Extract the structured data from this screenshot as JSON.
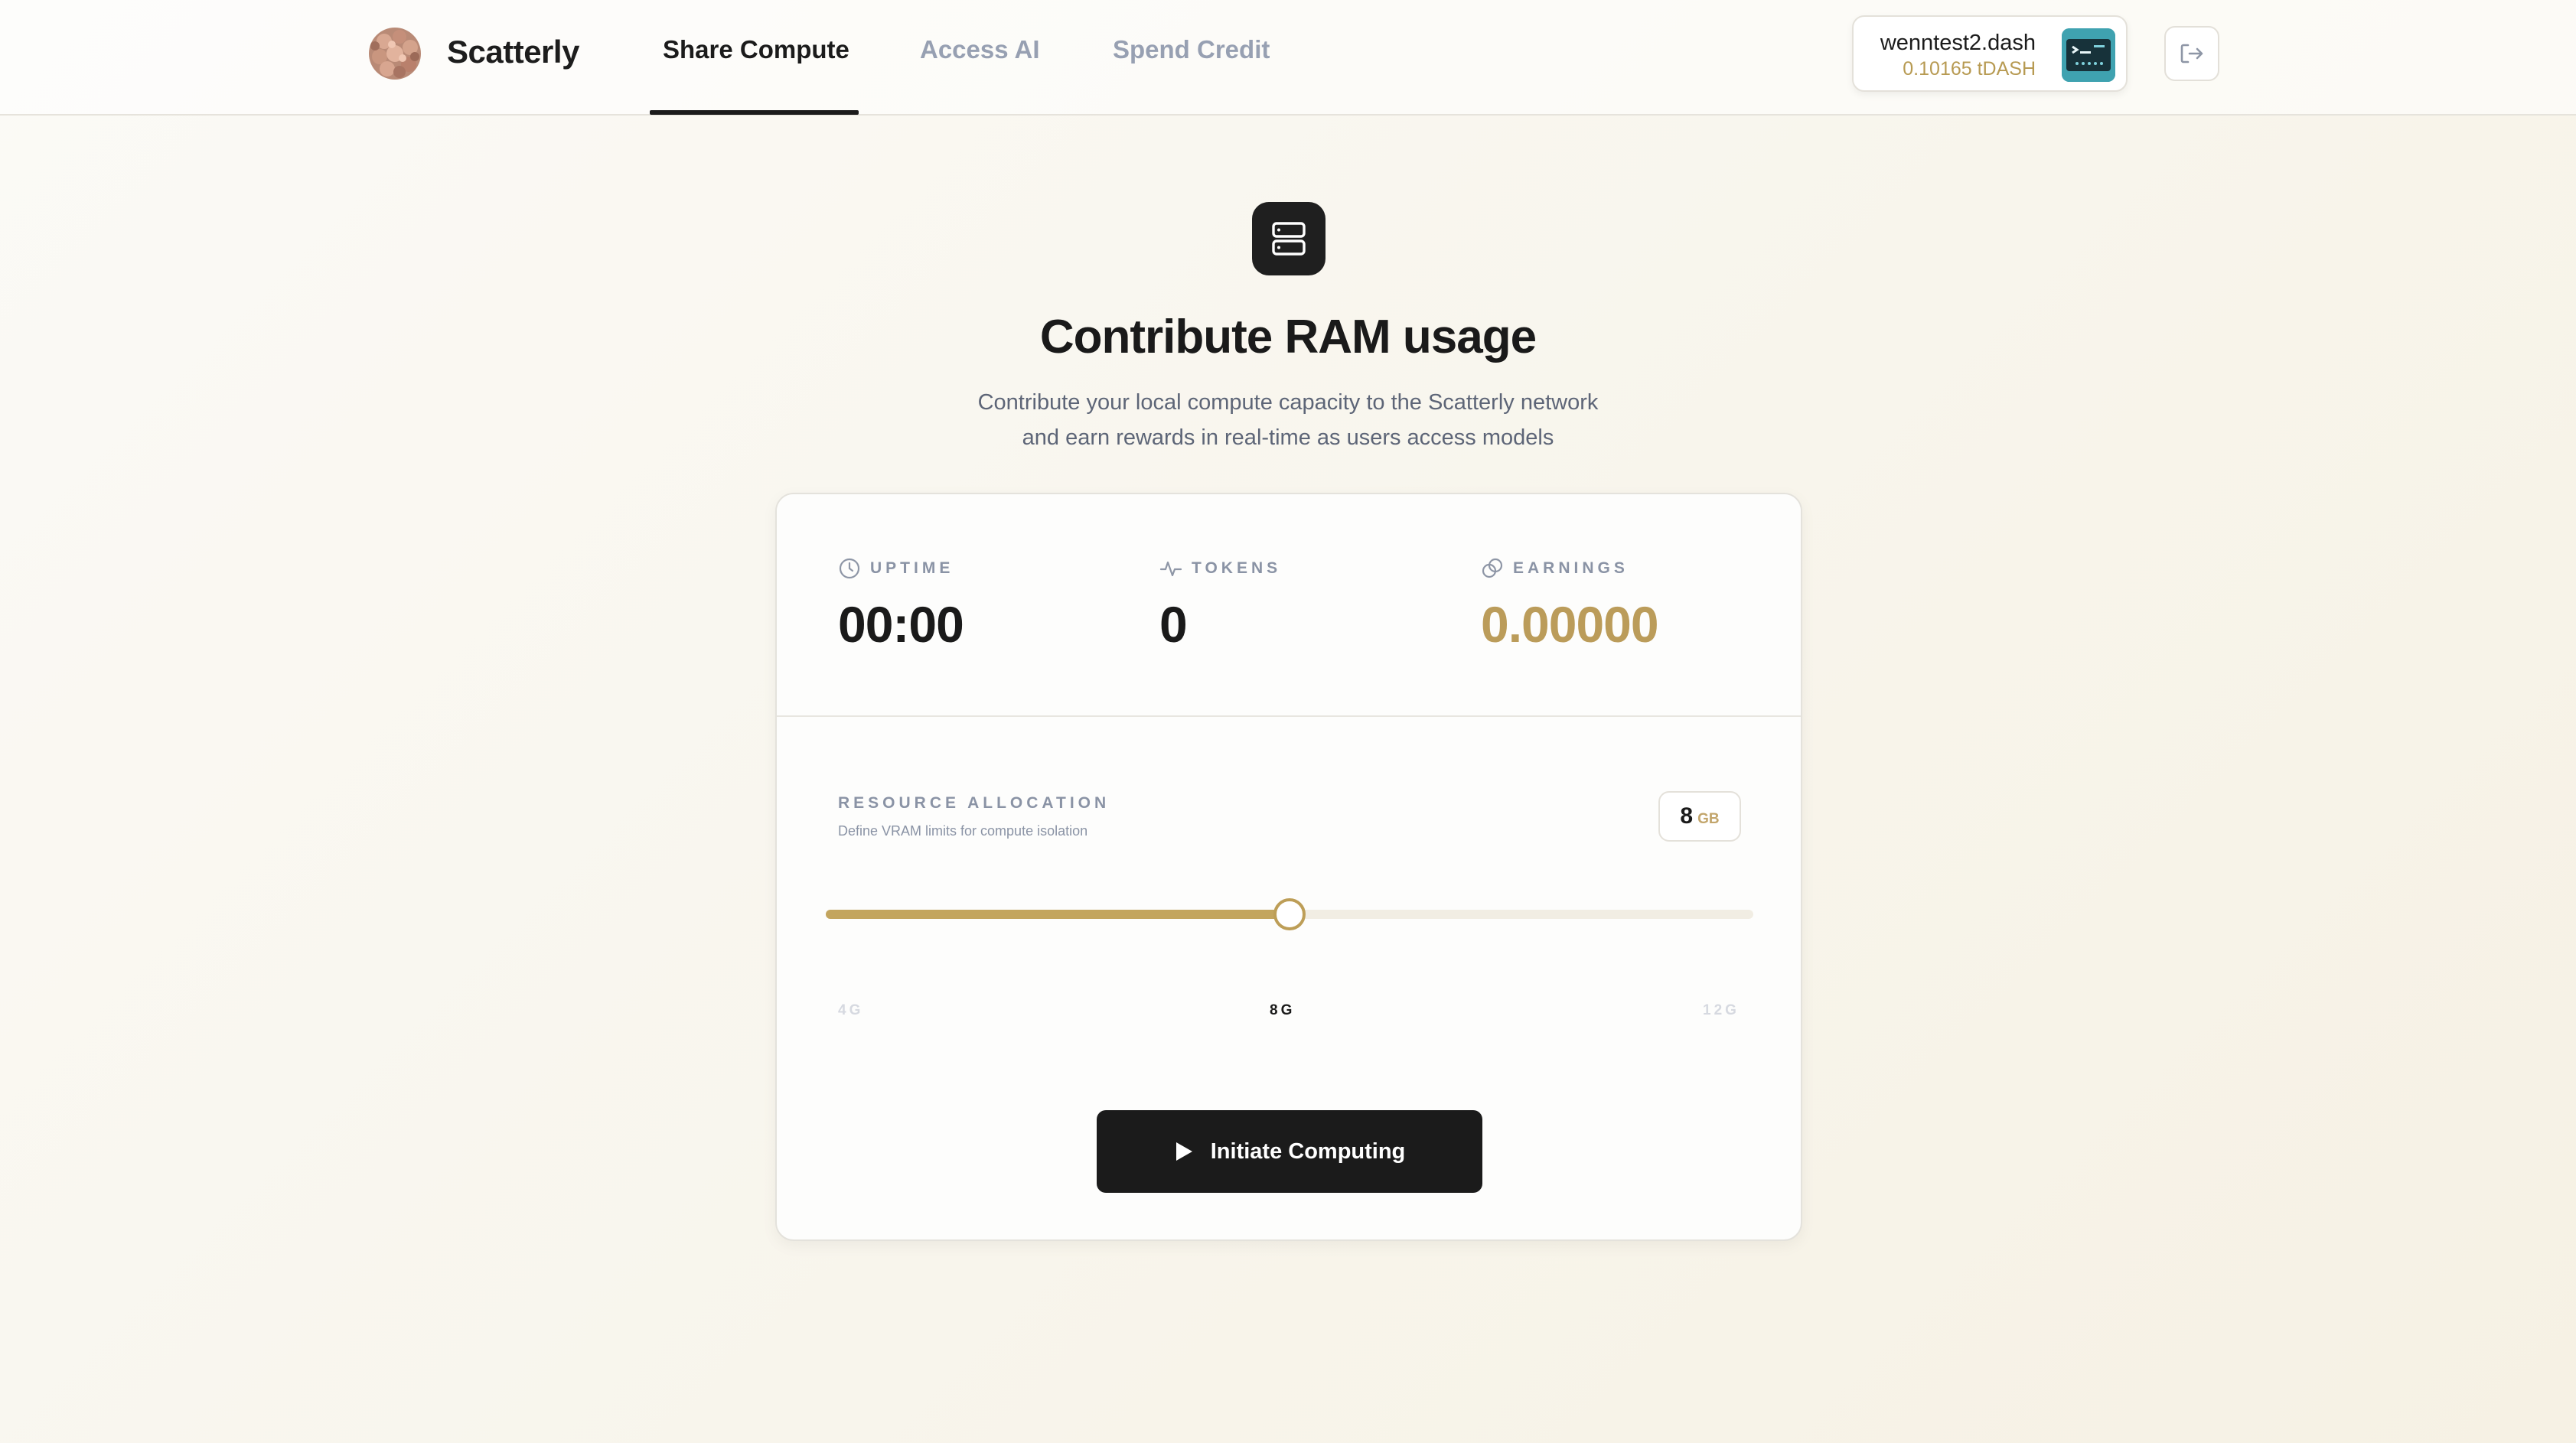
{
  "brand": {
    "name": "Scatterly",
    "logo": "molecule-logo-icon"
  },
  "nav": {
    "tabs": [
      {
        "label": "Share Compute",
        "active": true
      },
      {
        "label": "Access AI",
        "active": false
      },
      {
        "label": "Spend Credit",
        "active": false
      }
    ]
  },
  "wallet": {
    "name": "wenntest2.dash",
    "balance": "0.10165 tDASH",
    "avatar": "terminal-avatar-icon",
    "logout_icon": "logout-icon"
  },
  "hero": {
    "icon": "server-icon",
    "title": "Contribute RAM usage",
    "subtitle_line1": "Contribute your local compute capacity to the Scatterly network",
    "subtitle_line2": "and earn rewards in real-time as users access models"
  },
  "stats": {
    "uptime": {
      "label": "UPTIME",
      "value": "00:00",
      "icon": "clock-icon"
    },
    "tokens": {
      "label": "TOKENS",
      "value": "0",
      "icon": "activity-icon"
    },
    "earnings": {
      "label": "EARNINGS",
      "value": "0.00000",
      "icon": "coins-icon"
    }
  },
  "allocation": {
    "label": "RESOURCE ALLOCATION",
    "description": "Define VRAM limits for compute isolation",
    "value": "8",
    "unit": "GB",
    "slider": {
      "min": 4,
      "max": 12,
      "value": 8
    },
    "ticks": {
      "min": "4G",
      "current": "8G",
      "max": "12G"
    }
  },
  "action": {
    "label": "Initiate Computing",
    "icon": "play-icon"
  },
  "colors": {
    "accent_gold": "#c3a55e",
    "dark": "#1b1b1b",
    "muted": "#8a93a5"
  }
}
